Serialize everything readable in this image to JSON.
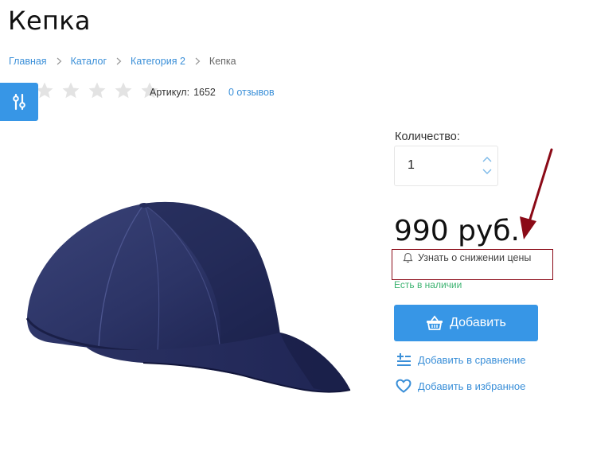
{
  "page": {
    "title": "Кепка"
  },
  "breadcrumb": {
    "items": [
      {
        "label": "Главная"
      },
      {
        "label": "Каталог"
      },
      {
        "label": "Категория 2"
      }
    ],
    "current": "Кепка"
  },
  "product": {
    "rating": {
      "value": 0,
      "max": 5
    },
    "article_label": "Артикул:",
    "article_value": "1652",
    "reviews": "0 отзывов",
    "quantity_label": "Количество:",
    "quantity_value": "1",
    "price": "990 руб.",
    "price_alert": "Узнать о снижении цены",
    "stock_status": "Есть в наличии",
    "add_button": "Добавить",
    "compare": "Добавить в сравнение",
    "favorite": "Добавить в избранное"
  },
  "colors": {
    "accent": "#3796e6",
    "link": "#3a8fd8",
    "stock": "#3cb371",
    "annotation": "#8b0a17",
    "cap": "#2a3160"
  },
  "icons": [
    "filter-icon",
    "star-icon",
    "chevron-up-icon",
    "chevron-down-icon",
    "bell-icon",
    "basket-icon",
    "compare-icon",
    "heart-icon"
  ]
}
